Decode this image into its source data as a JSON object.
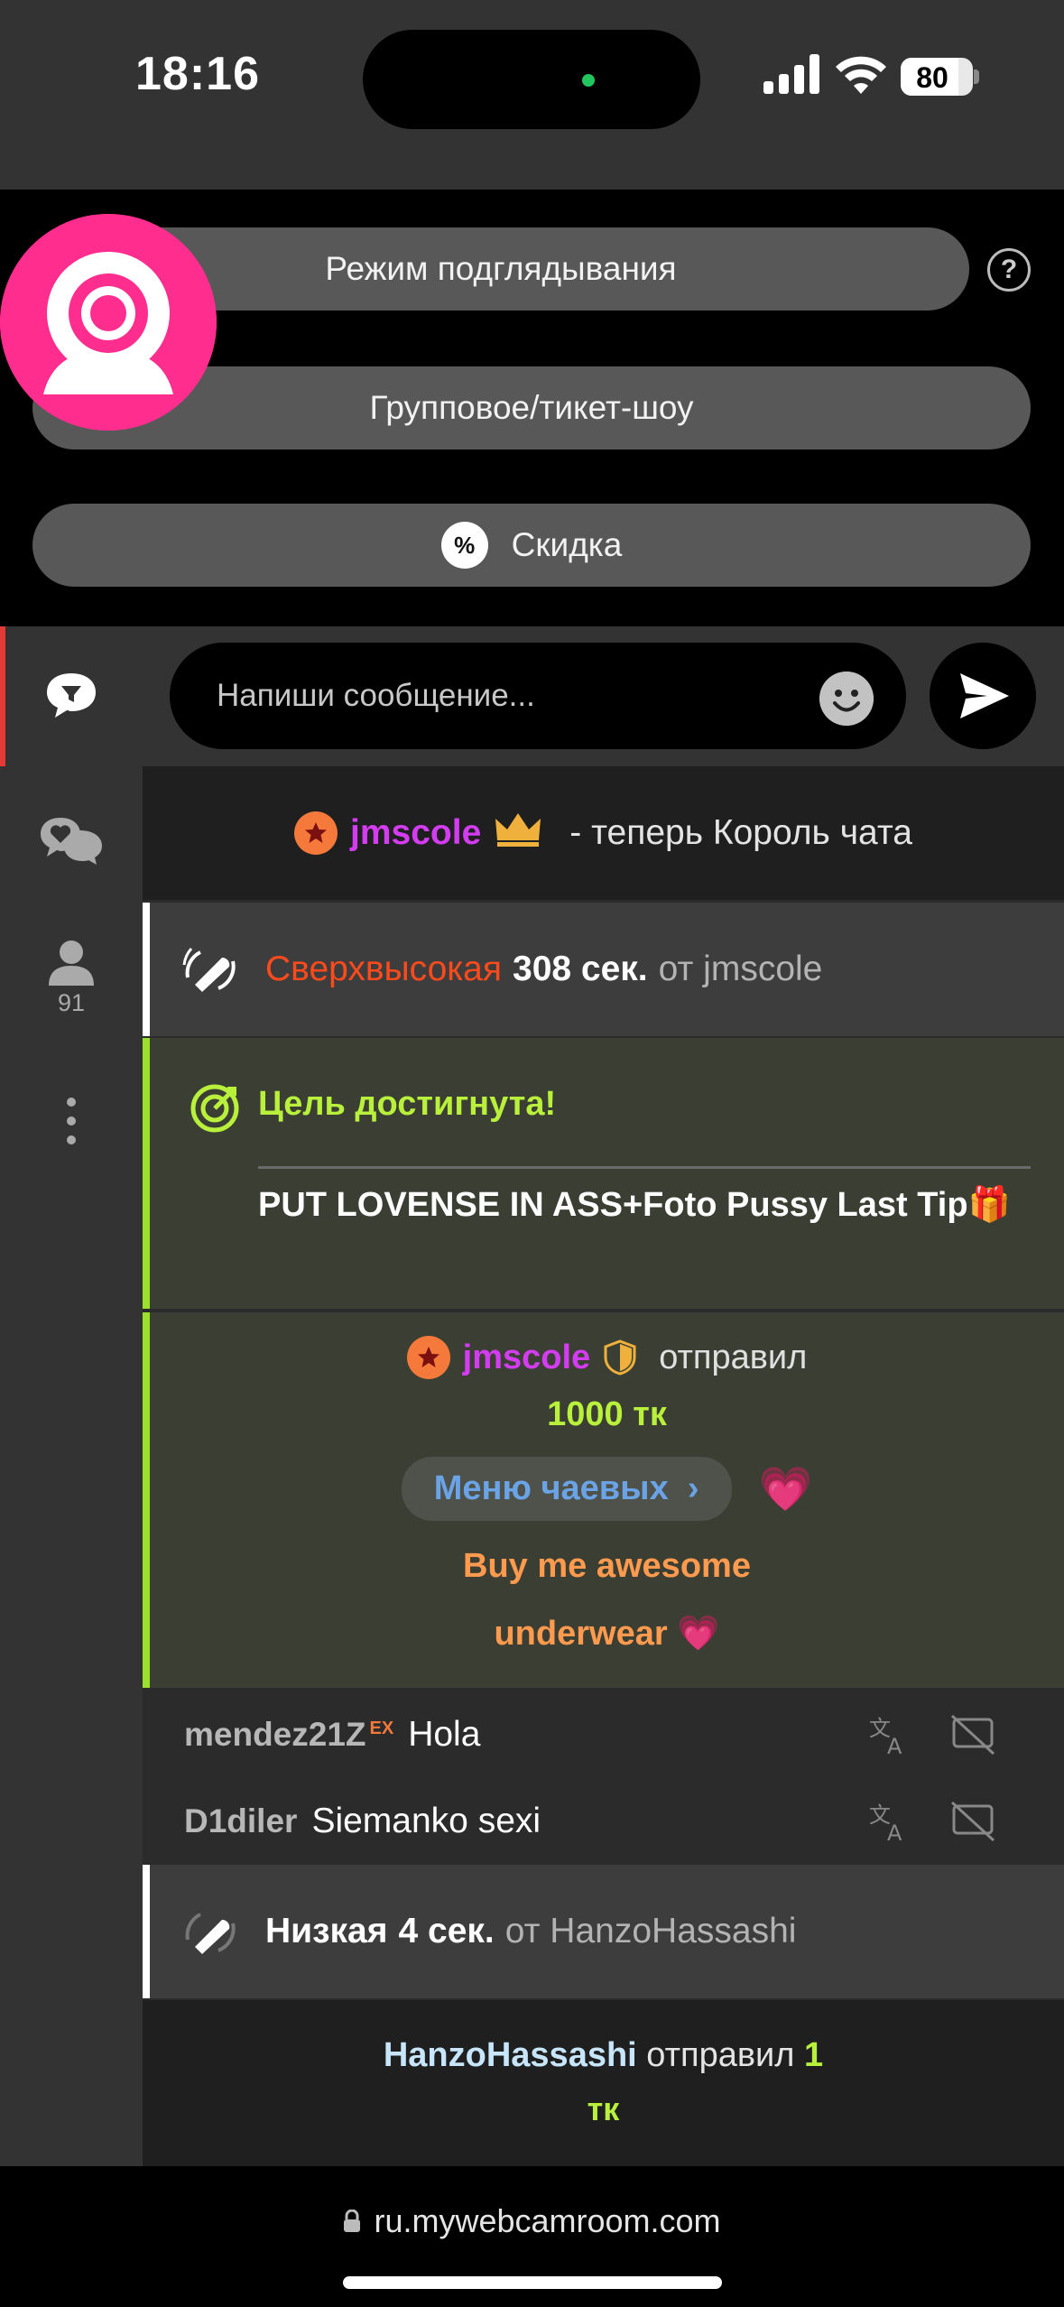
{
  "status_bar": {
    "time": "18:16",
    "battery": "80",
    "battery_level": 0.8
  },
  "top_panel": {
    "peek_mode_label": "Режим подглядывания",
    "help_label": "?",
    "group_show_label": "Групповое/тикет-шоу",
    "discount_label": "Скидка",
    "discount_badge": "%"
  },
  "sidebar": {
    "users_count": "91"
  },
  "composer": {
    "placeholder": "Напиши сообщение..."
  },
  "messages": {
    "king": {
      "username": "jmscole",
      "text": "- теперь Король чата"
    },
    "vibe1": {
      "level": "Сверхвысокая",
      "duration": "308 сек.",
      "from": "от jmscole"
    },
    "goal": {
      "title": "Цель достигнута!",
      "text": "PUT LOVENSE IN ASS+Foto Pussy Last Tip🎁"
    },
    "tip": {
      "username": "jmscole",
      "action": "отправил",
      "amount": "1000 тк",
      "menu_label": "Меню чаевых",
      "heart": "💗",
      "message_line1": "Buy me awesome",
      "message_line2": "underwear 💗"
    },
    "chat": [
      {
        "user": "mendez21Z",
        "badge": "EX",
        "text": "Hola"
      },
      {
        "user": "D1diler",
        "badge": "",
        "text": "Siemanko sexi"
      }
    ],
    "vibe2": {
      "level": "Низкая",
      "duration": "4 сек.",
      "from": "от HanzoHassashi"
    },
    "low_tip": {
      "username": "HanzoHassashi",
      "action": "отправил",
      "amount": "1",
      "unit": "тк"
    }
  },
  "browser": {
    "url": "ru.mywebcamroom.com"
  },
  "colors": {
    "accent": "#ff2d8e",
    "goal_green": "#b8f03c",
    "red": "#ff4a1c",
    "purple_user": "#d33cf0"
  }
}
